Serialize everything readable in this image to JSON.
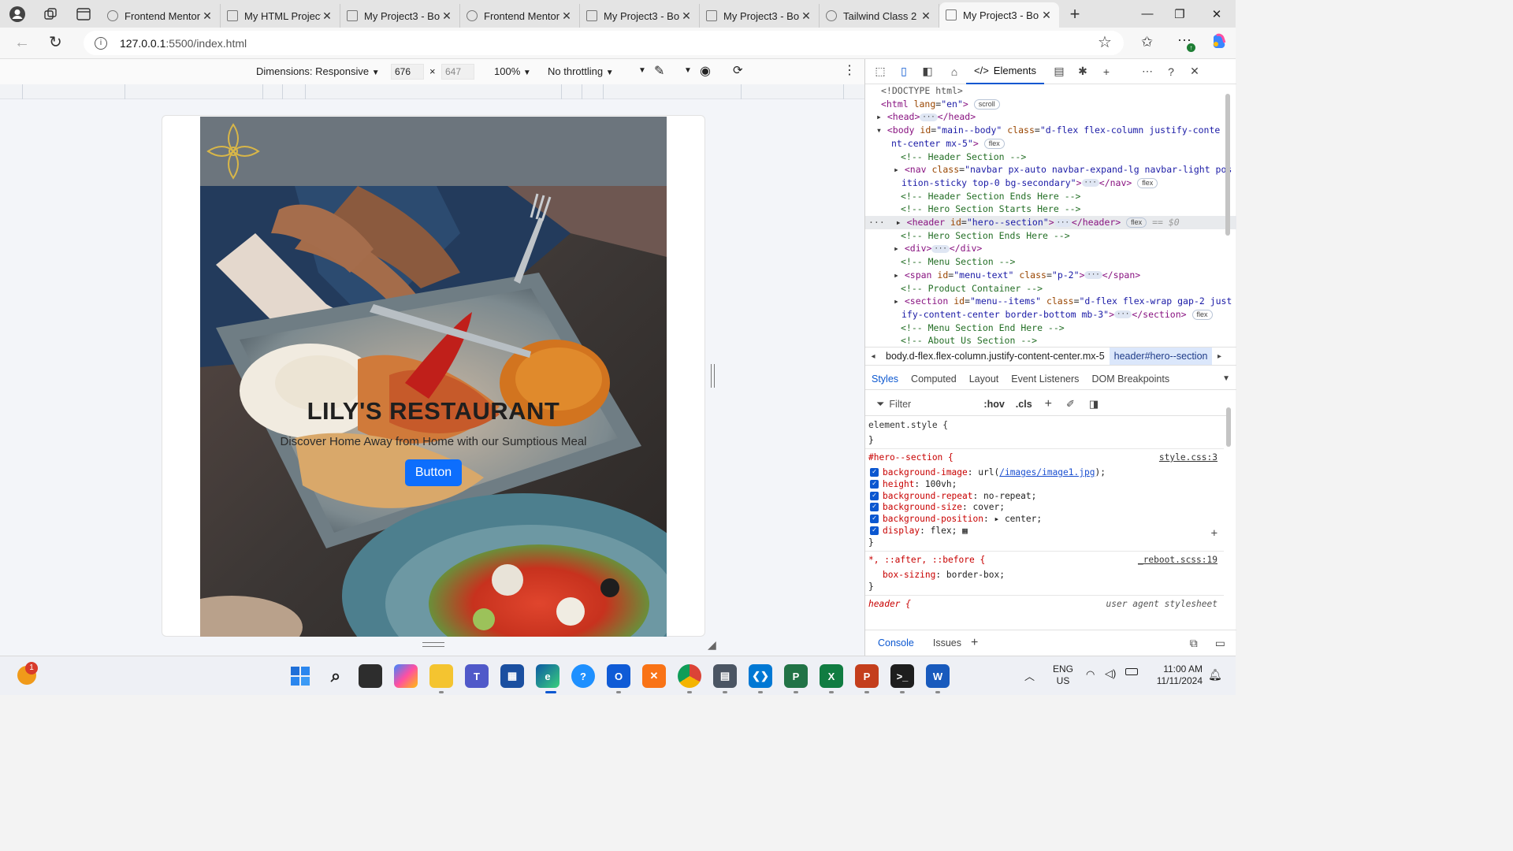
{
  "browser": {
    "tabs": [
      {
        "title": "Frontend Mentor",
        "active": false
      },
      {
        "title": "My HTML Project",
        "active": false
      },
      {
        "title": "My Project3 - Bo",
        "active": false
      },
      {
        "title": "Frontend Mentor",
        "active": false
      },
      {
        "title": "My Project3 - Bo",
        "active": false
      },
      {
        "title": "My Project3 - Bo",
        "active": false
      },
      {
        "title": "Tailwind Class 2",
        "active": false
      },
      {
        "title": "My Project3 - Bo",
        "active": true
      }
    ],
    "url_host": "127.0.0.1",
    "url_path": ":5500/index.html"
  },
  "device_toolbar": {
    "dimensions_label": "Dimensions: Responsive",
    "width": "676",
    "height": "647",
    "times": "×",
    "zoom": "100%",
    "throttling": "No throttling"
  },
  "site": {
    "hero_title": "LILY'S RESTAURANT",
    "hero_subtitle": "Discover Home Away from Home with our Sumptious Meal",
    "hero_button": "Button"
  },
  "devtools": {
    "elements_tab": "Elements",
    "dom": {
      "doctype": "<!DOCTYPE html>",
      "html_open": "<html",
      "html_attr": "lang",
      "html_val": "\"en\"",
      "html_close": ">",
      "scroll_badge": "scroll",
      "head": "<head>",
      "head_end": "</head>",
      "body_open": "<body",
      "body_id_attr": "id",
      "body_id_val": "\"main--body\"",
      "body_class_attr": "class",
      "body_class_val_1": "\"d-flex flex-column justify-conte",
      "body_class_val_2": "nt-center mx-5\"",
      "flex": "flex",
      "c_header": "<!-- Header Section -->",
      "nav_open": "<nav",
      "nav_class_val_1": "\"navbar px-auto navbar-expand-lg navbar-light pos",
      "nav_class_val_2": "ition-sticky top-0 bg-secondary\"",
      "nav_end": "</nav>",
      "c_header_end": "<!-- Header Section Ends Here -->",
      "c_hero_start": "<!-- Hero Section Starts Here -->",
      "header_open": "<header",
      "header_id_val": "\"hero--section\"",
      "header_end": "</header>",
      "dollar0": "== $0",
      "c_hero_end": "<!-- Hero Section Ends Here -->",
      "div_open": "<div>",
      "div_end": "</div>",
      "c_menu": "<!-- Menu Section -->",
      "span_open": "<span",
      "span_id_val": "\"menu-text\"",
      "span_class_val": "\"p-2\"",
      "span_end": "</span>",
      "c_product": "<!-- Product Container -->",
      "section_open": "<section",
      "section_id_val": "\"menu--items\"",
      "section_class_val_1": "\"d-flex flex-wrap gap-2 just",
      "section_class_val_2": "ify-content-center border-bottom mb-3\"",
      "section_end": "</section>",
      "c_menu_end": "<!-- Menu Section End Here -->",
      "c_about": "<!-- About Us Section -->"
    },
    "breadcrumb_1": "body.d-flex.flex-column.justify-content-center.mx-5",
    "breadcrumb_2": "header#hero--section",
    "subtabs": [
      "Styles",
      "Computed",
      "Layout",
      "Event Listeners",
      "DOM Breakpoints"
    ],
    "filter_placeholder": "Filter",
    "hov": ":hov",
    "cls": ".cls",
    "styles": {
      "element_style": "element.style {",
      "close_brace": "}",
      "hero_selector": "#hero--section {",
      "hero_source": "style.css:3",
      "hero_decls": [
        {
          "prop": "background-image",
          "pre": "url(",
          "link": "/images/image1.jpg",
          "post": ");"
        },
        {
          "prop": "height",
          "pre": "100vh;",
          "link": "",
          "post": ""
        },
        {
          "prop": "background-repeat",
          "pre": "no-repeat;",
          "link": "",
          "post": ""
        },
        {
          "prop": "background-size",
          "pre": "cover;",
          "link": "",
          "post": ""
        },
        {
          "prop": "background-position",
          "pre": "▸ center;",
          "link": "",
          "post": ""
        },
        {
          "prop": "display",
          "pre": "flex;",
          "link": "",
          "post": ""
        }
      ],
      "star_selector": "*, ::after, ::before {",
      "star_source": "_reboot.scss:19",
      "star_prop": "box-sizing",
      "star_val": "border-box;",
      "header_selector": "header {",
      "header_source": "user agent stylesheet"
    },
    "console": "Console",
    "issues": "Issues"
  },
  "taskbar": {
    "lang": "ENG",
    "region": "US",
    "time": "11:00 AM",
    "date": "11/11/2024",
    "notification_count": "1"
  }
}
